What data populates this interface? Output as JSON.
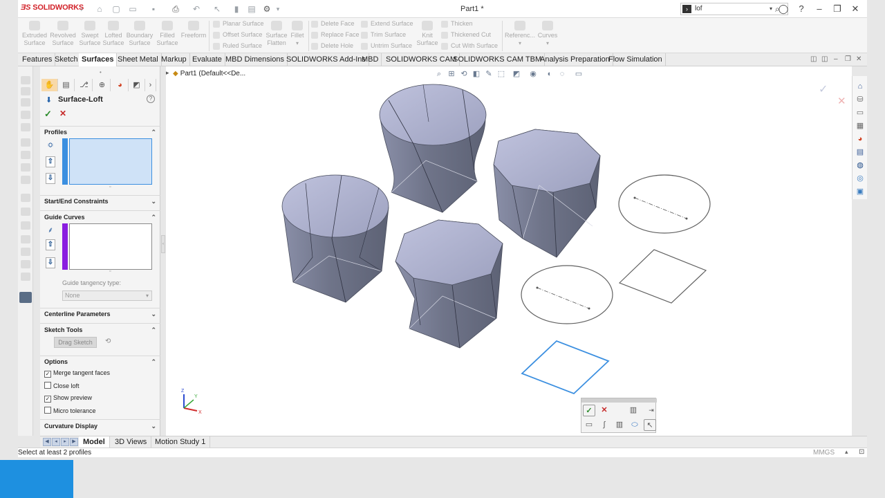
{
  "titlebar": {
    "app_name": "SOLIDWORKS",
    "document_title": "Part1 *",
    "search_value": "lof"
  },
  "command_manager": {
    "surface_tools": [
      {
        "label": "Extruded Surface",
        "icon": "extruded-surface-icon"
      },
      {
        "label": "Revolved Surface",
        "icon": "revolved-surface-icon"
      },
      {
        "label": "Swept Surface",
        "icon": "swept-surface-icon"
      },
      {
        "label": "Lofted Surface",
        "icon": "lofted-surface-icon"
      },
      {
        "label": "Boundary Surface",
        "icon": "boundary-surface-icon"
      },
      {
        "label": "Filled Surface",
        "icon": "filled-surface-icon"
      },
      {
        "label": "Freeform",
        "icon": "freeform-icon"
      }
    ],
    "group2": [
      "Planar Surface",
      "Offset Surface",
      "Ruled Surface"
    ],
    "surface_flatten": "Surface Flatten",
    "fillet": "Fillet",
    "group3": [
      "Delete Face",
      "Replace Face",
      "Delete Hole"
    ],
    "group4": [
      "Extend Surface",
      "Trim Surface",
      "Untrim Surface"
    ],
    "knit_surface": "Knit Surface",
    "group5": [
      "Thicken",
      "Thickened Cut",
      "Cut With Surface"
    ],
    "reference": "Referenc...",
    "curves": "Curves"
  },
  "tabs": [
    "Features",
    "Sketch",
    "Surfaces",
    "Sheet Metal",
    "Markup",
    "Evaluate",
    "MBD Dimensions",
    "SOLIDWORKS Add-Ins",
    "MBD",
    "SOLIDWORKS CAM",
    "SOLIDWORKS CAM TBM",
    "Analysis Preparation",
    "Flow Simulation"
  ],
  "active_tab": "Surfaces",
  "property_manager": {
    "title": "Surface-Loft",
    "sections": {
      "profiles": "Profiles",
      "start_end": "Start/End Constraints",
      "guide_curves": "Guide Curves",
      "guide_tangency_label": "Guide tangency type:",
      "guide_tangency_value": "None",
      "centerline": "Centerline Parameters",
      "sketch_tools": "Sketch Tools",
      "drag_sketch": "Drag Sketch",
      "options": "Options",
      "curvature": "Curvature Display"
    },
    "options": [
      {
        "label": "Merge tangent faces",
        "checked": true
      },
      {
        "label": "Close loft",
        "checked": false
      },
      {
        "label": "Show preview",
        "checked": true
      },
      {
        "label": "Micro tolerance",
        "checked": false
      }
    ],
    "colors": {
      "profiles_bar": "#3b8fe0",
      "guide_bar": "#8a1ee0"
    }
  },
  "viewport": {
    "tree_item": "Part1  (Default<<De..."
  },
  "model_tabs": [
    "Model",
    "3D Views",
    "Motion Study 1"
  ],
  "active_model_tab": "Model",
  "status": {
    "message": "Select at least 2 profiles",
    "units": "MMGS"
  }
}
